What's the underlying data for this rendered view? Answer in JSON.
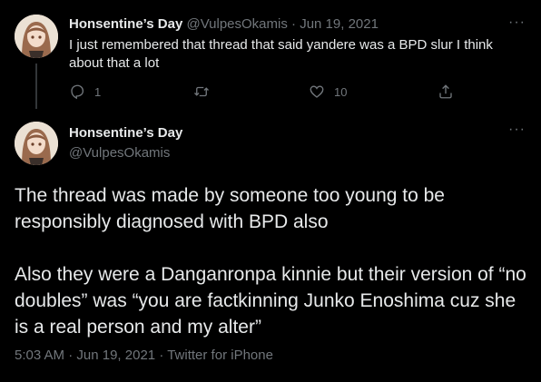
{
  "reply": {
    "display_name": "Honsentine’s Day",
    "handle": "@VulpesOkamis",
    "separator": "·",
    "date": "Jun 19, 2021",
    "text": "I just remembered that thread that said yandere was a BPD slur I think about that a lot",
    "more": "···",
    "reply_count": "1",
    "retweet_count": "",
    "like_count": "10"
  },
  "main": {
    "display_name": "Honsentine’s Day",
    "handle": "@VulpesOkamis",
    "more": "···",
    "paragraph_1": "The thread was made by someone too young to be responsibly diagnosed with BPD also",
    "paragraph_2": "Also they were a Danganronpa kinnie but their version of “no doubles” was “you are factkinning Junko Enoshima cuz she is a real person and my alter”",
    "time": "5:03 AM",
    "separator": "·",
    "date": "Jun 19, 2021",
    "source": "Twitter for iPhone"
  },
  "icons": {
    "reply": "reply-icon",
    "retweet": "retweet-icon",
    "like": "heart-icon",
    "share": "share-icon",
    "more": "more-icon"
  },
  "colors": {
    "background": "#000000",
    "text": "#e7e9ea",
    "muted": "#71767b",
    "thread_line": "#333639"
  }
}
